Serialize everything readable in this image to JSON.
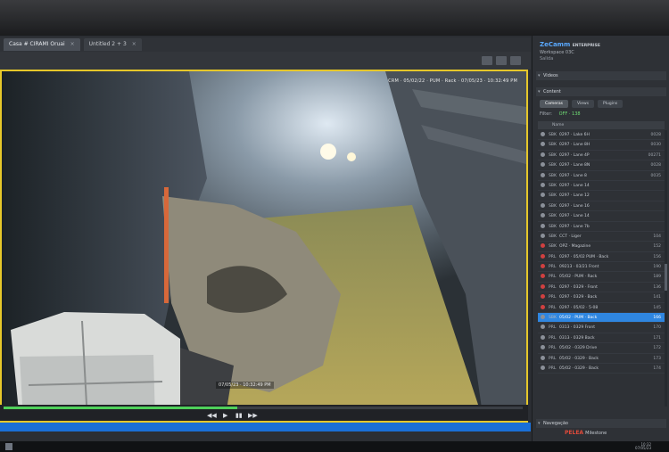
{
  "tabs": [
    {
      "label": "Casa # CIRAMI Oruai",
      "active": true
    },
    {
      "label": "Untitled 2 + 3",
      "active": false
    }
  ],
  "video": {
    "overlay_top": "CRM · 05/02/22 · PUM · Rack · 07/05/23 · 10:32:49 PM",
    "overlay_bottom": "07/05/23 · 10:32:49 PM"
  },
  "playback": {
    "controls": [
      "◀◀",
      "▶",
      "▮▮",
      "▶▶"
    ]
  },
  "panel": {
    "brand": "ZeCamm",
    "brand_suffix": "ENTERPRISE",
    "sub1": "Workspace 03C",
    "sub2": "Salida",
    "section_video": "Videos",
    "section_content": "Content",
    "tabs": [
      "Cameras",
      "Views",
      "Plugins"
    ],
    "filter_label": "Filter: ",
    "filter_value": "OFF · 138",
    "column_header": "Name"
  },
  "rows": [
    {
      "code": "SBK",
      "name": "0297 · Lake 6H",
      "right": "0028",
      "alarm": false,
      "selected": false
    },
    {
      "code": "SBK",
      "name": "0297 · Lane 8H",
      "right": "0030",
      "alarm": false,
      "selected": false
    },
    {
      "code": "SBK",
      "name": "0297 · Lane 4P",
      "right": "00271",
      "alarm": false,
      "selected": false
    },
    {
      "code": "SBK",
      "name": "0297 · Lane 8N",
      "right": "0028",
      "alarm": false,
      "selected": false
    },
    {
      "code": "SBK",
      "name": "0297 · Lane 8",
      "right": "0035",
      "alarm": false,
      "selected": false
    },
    {
      "code": "SBK",
      "name": "0297 · Lane 14",
      "right": "",
      "alarm": false,
      "selected": false
    },
    {
      "code": "SBK",
      "name": "0297 · Lane 12",
      "right": "",
      "alarm": false,
      "selected": false
    },
    {
      "code": "SBK",
      "name": "0297 · Lane 16",
      "right": "",
      "alarm": false,
      "selected": false
    },
    {
      "code": "SBK",
      "name": "0297 · Lane 14",
      "right": "",
      "alarm": false,
      "selected": false
    },
    {
      "code": "SBK",
      "name": "0297 · Lane 7b",
      "right": "",
      "alarm": false,
      "selected": false
    },
    {
      "code": "SBK",
      "name": "CCT · Liger",
      "right": "104",
      "alarm": false,
      "selected": false
    },
    {
      "code": "SBK",
      "name": "OPZ · Magazine",
      "right": "152",
      "alarm": true,
      "selected": false
    },
    {
      "code": "PRL",
      "name": "0297 · 05/02 PUM · Back",
      "right": "156",
      "alarm": true,
      "selected": false
    },
    {
      "code": "PRL",
      "name": "09213 · 03/21 Front",
      "right": "190",
      "alarm": true,
      "selected": false
    },
    {
      "code": "PRL",
      "name": "05/02 · PUM · Rack",
      "right": "189",
      "alarm": true,
      "selected": false
    },
    {
      "code": "PRL",
      "name": "0297 · 0329 · Front",
      "right": "136",
      "alarm": true,
      "selected": false
    },
    {
      "code": "PRL",
      "name": "0297 · 0329 · Back",
      "right": "141",
      "alarm": true,
      "selected": false
    },
    {
      "code": "PRL",
      "name": "0297 · 05/02 · 5-08",
      "right": "145",
      "alarm": true,
      "selected": false
    },
    {
      "code": "SBK",
      "name": "05/02 · PUM · Back",
      "right": "166",
      "alarm": false,
      "selected": true
    },
    {
      "code": "PRL",
      "name": "0313 · 0329 Front",
      "right": "170",
      "alarm": false,
      "selected": false
    },
    {
      "code": "PRL",
      "name": "0313 · 0329 Back",
      "right": "171",
      "alarm": false,
      "selected": false
    },
    {
      "code": "PRL",
      "name": "05/02 · 0329 Drive",
      "right": "172",
      "alarm": false,
      "selected": false
    },
    {
      "code": "PRL",
      "name": "05/02 · 0329 · Back",
      "right": "173",
      "alarm": false,
      "selected": false
    },
    {
      "code": "PRL",
      "name": "05/02 · 0329 · Back",
      "right": "174",
      "alarm": false,
      "selected": false
    }
  ],
  "navigation_head": "Navegação",
  "footer_brand": {
    "a": "PELEA",
    "b": "Milestone"
  },
  "taskbar": {
    "time": "10:32",
    "date": "07/05/23"
  },
  "colors": {
    "highlight": "#e6c72a",
    "selection": "#2f86e0",
    "progress": "#4fd05a",
    "alarm": "#d04040"
  }
}
